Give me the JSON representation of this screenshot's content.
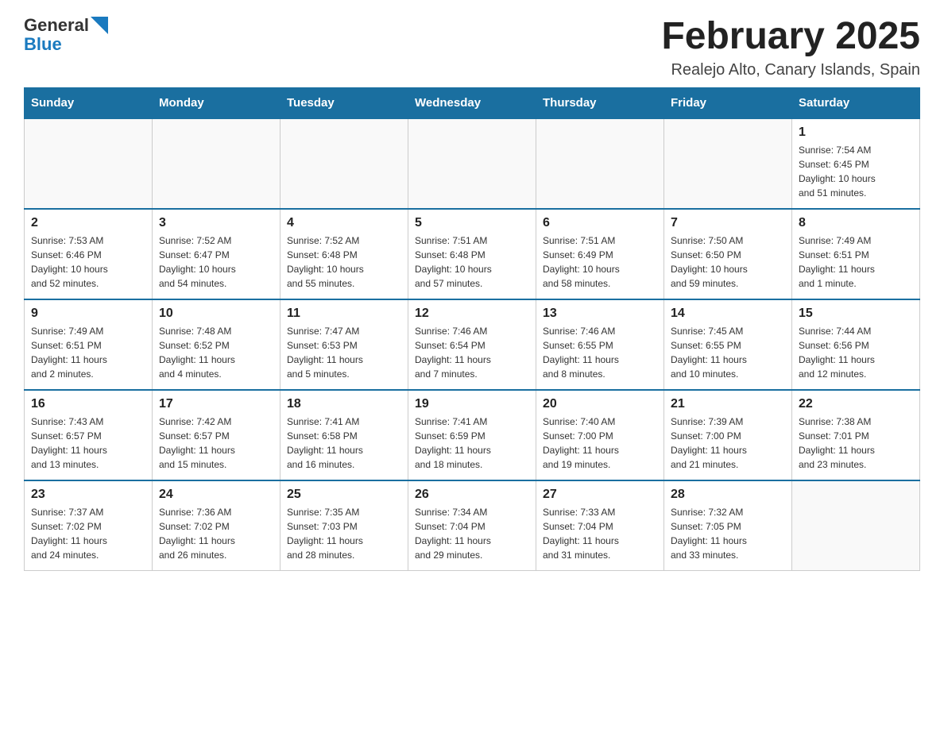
{
  "logo": {
    "text_general": "General",
    "text_blue": "Blue",
    "arrow_color": "#1a7abf"
  },
  "header": {
    "month_year": "February 2025",
    "location": "Realejo Alto, Canary Islands, Spain"
  },
  "weekdays": [
    "Sunday",
    "Monday",
    "Tuesday",
    "Wednesday",
    "Thursday",
    "Friday",
    "Saturday"
  ],
  "weeks": [
    [
      {
        "day": "",
        "info": ""
      },
      {
        "day": "",
        "info": ""
      },
      {
        "day": "",
        "info": ""
      },
      {
        "day": "",
        "info": ""
      },
      {
        "day": "",
        "info": ""
      },
      {
        "day": "",
        "info": ""
      },
      {
        "day": "1",
        "info": "Sunrise: 7:54 AM\nSunset: 6:45 PM\nDaylight: 10 hours\nand 51 minutes."
      }
    ],
    [
      {
        "day": "2",
        "info": "Sunrise: 7:53 AM\nSunset: 6:46 PM\nDaylight: 10 hours\nand 52 minutes."
      },
      {
        "day": "3",
        "info": "Sunrise: 7:52 AM\nSunset: 6:47 PM\nDaylight: 10 hours\nand 54 minutes."
      },
      {
        "day": "4",
        "info": "Sunrise: 7:52 AM\nSunset: 6:48 PM\nDaylight: 10 hours\nand 55 minutes."
      },
      {
        "day": "5",
        "info": "Sunrise: 7:51 AM\nSunset: 6:48 PM\nDaylight: 10 hours\nand 57 minutes."
      },
      {
        "day": "6",
        "info": "Sunrise: 7:51 AM\nSunset: 6:49 PM\nDaylight: 10 hours\nand 58 minutes."
      },
      {
        "day": "7",
        "info": "Sunrise: 7:50 AM\nSunset: 6:50 PM\nDaylight: 10 hours\nand 59 minutes."
      },
      {
        "day": "8",
        "info": "Sunrise: 7:49 AM\nSunset: 6:51 PM\nDaylight: 11 hours\nand 1 minute."
      }
    ],
    [
      {
        "day": "9",
        "info": "Sunrise: 7:49 AM\nSunset: 6:51 PM\nDaylight: 11 hours\nand 2 minutes."
      },
      {
        "day": "10",
        "info": "Sunrise: 7:48 AM\nSunset: 6:52 PM\nDaylight: 11 hours\nand 4 minutes."
      },
      {
        "day": "11",
        "info": "Sunrise: 7:47 AM\nSunset: 6:53 PM\nDaylight: 11 hours\nand 5 minutes."
      },
      {
        "day": "12",
        "info": "Sunrise: 7:46 AM\nSunset: 6:54 PM\nDaylight: 11 hours\nand 7 minutes."
      },
      {
        "day": "13",
        "info": "Sunrise: 7:46 AM\nSunset: 6:55 PM\nDaylight: 11 hours\nand 8 minutes."
      },
      {
        "day": "14",
        "info": "Sunrise: 7:45 AM\nSunset: 6:55 PM\nDaylight: 11 hours\nand 10 minutes."
      },
      {
        "day": "15",
        "info": "Sunrise: 7:44 AM\nSunset: 6:56 PM\nDaylight: 11 hours\nand 12 minutes."
      }
    ],
    [
      {
        "day": "16",
        "info": "Sunrise: 7:43 AM\nSunset: 6:57 PM\nDaylight: 11 hours\nand 13 minutes."
      },
      {
        "day": "17",
        "info": "Sunrise: 7:42 AM\nSunset: 6:57 PM\nDaylight: 11 hours\nand 15 minutes."
      },
      {
        "day": "18",
        "info": "Sunrise: 7:41 AM\nSunset: 6:58 PM\nDaylight: 11 hours\nand 16 minutes."
      },
      {
        "day": "19",
        "info": "Sunrise: 7:41 AM\nSunset: 6:59 PM\nDaylight: 11 hours\nand 18 minutes."
      },
      {
        "day": "20",
        "info": "Sunrise: 7:40 AM\nSunset: 7:00 PM\nDaylight: 11 hours\nand 19 minutes."
      },
      {
        "day": "21",
        "info": "Sunrise: 7:39 AM\nSunset: 7:00 PM\nDaylight: 11 hours\nand 21 minutes."
      },
      {
        "day": "22",
        "info": "Sunrise: 7:38 AM\nSunset: 7:01 PM\nDaylight: 11 hours\nand 23 minutes."
      }
    ],
    [
      {
        "day": "23",
        "info": "Sunrise: 7:37 AM\nSunset: 7:02 PM\nDaylight: 11 hours\nand 24 minutes."
      },
      {
        "day": "24",
        "info": "Sunrise: 7:36 AM\nSunset: 7:02 PM\nDaylight: 11 hours\nand 26 minutes."
      },
      {
        "day": "25",
        "info": "Sunrise: 7:35 AM\nSunset: 7:03 PM\nDaylight: 11 hours\nand 28 minutes."
      },
      {
        "day": "26",
        "info": "Sunrise: 7:34 AM\nSunset: 7:04 PM\nDaylight: 11 hours\nand 29 minutes."
      },
      {
        "day": "27",
        "info": "Sunrise: 7:33 AM\nSunset: 7:04 PM\nDaylight: 11 hours\nand 31 minutes."
      },
      {
        "day": "28",
        "info": "Sunrise: 7:32 AM\nSunset: 7:05 PM\nDaylight: 11 hours\nand 33 minutes."
      },
      {
        "day": "",
        "info": ""
      }
    ]
  ]
}
